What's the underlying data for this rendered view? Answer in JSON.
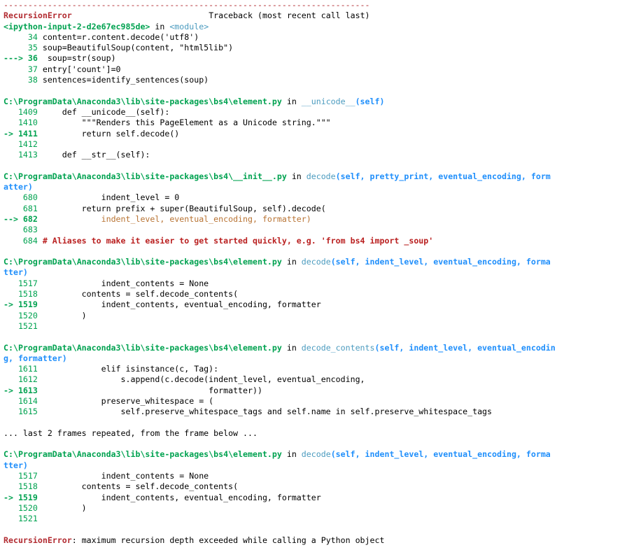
{
  "traceback": {
    "separator": "---------------------------------------------------------------------------",
    "error_name": "RecursionError",
    "header_gap": "                            ",
    "header_title": "Traceback (most recent call last)",
    "entry": {
      "module": "<ipython-input-2-d2e67ec985de>",
      "in": " in ",
      "func": "<module>",
      "lines": [
        {
          "num": "     34 ",
          "code": "content=r.content.decode('utf8')"
        },
        {
          "num": "     35 ",
          "code": "soup=BeautifulSoup(content, \"html5lib\")"
        },
        {
          "num": "---> 36 ",
          "code": " soup=str(soup)"
        },
        {
          "num": "     37 ",
          "code": "entry['count']=0"
        },
        {
          "num": "     38 ",
          "code": "sentences=identify_sentences(soup)"
        }
      ]
    },
    "frames": [
      {
        "path": "C:\\ProgramData\\Anaconda3\\lib\\site-packages\\bs4\\element.py",
        "in": " in ",
        "func": "__unicode__",
        "args": "(self)",
        "args_wrap": "",
        "lines": [
          {
            "num": "   1409 ",
            "code": "    def __unicode__(self):"
          },
          {
            "num": "   1410 ",
            "code": "        \"\"\"Renders this PageElement as a Unicode string.\"\"\""
          },
          {
            "num": "-> 1411 ",
            "code": "        return self.decode()"
          },
          {
            "num": "   1412 ",
            "code": ""
          },
          {
            "num": "   1413 ",
            "code": "    def __str__(self):"
          }
        ]
      },
      {
        "path": "C:\\ProgramData\\Anaconda3\\lib\\site-packages\\bs4\\__init__.py",
        "in": " in ",
        "func": "decode",
        "args": "(self, pretty_print, eventual_encoding, form",
        "args_wrap": "atter)",
        "lines": [
          {
            "num": "    680 ",
            "code": "            indent_level = 0"
          },
          {
            "num": "    681 ",
            "code": "        return prefix + super(BeautifulSoup, self).decode("
          },
          {
            "num": "--> 682 ",
            "code": "            indent_level, eventual_encoding, formatter)"
          },
          {
            "num": "    683 ",
            "code": ""
          },
          {
            "num": "    684 ",
            "code": "# Aliases to make it easier to get started quickly, e.g. 'from bs4 import _soup'"
          }
        ]
      },
      {
        "path": "C:\\ProgramData\\Anaconda3\\lib\\site-packages\\bs4\\element.py",
        "in": " in ",
        "func": "decode",
        "args": "(self, indent_level, eventual_encoding, forma",
        "args_wrap": "tter)",
        "lines": [
          {
            "num": "   1517 ",
            "code": "            indent_contents = None"
          },
          {
            "num": "   1518 ",
            "code": "        contents = self.decode_contents("
          },
          {
            "num": "-> 1519 ",
            "code": "            indent_contents, eventual_encoding, formatter"
          },
          {
            "num": "   1520 ",
            "code": "        )"
          },
          {
            "num": "   1521 ",
            "code": ""
          }
        ]
      },
      {
        "path": "C:\\ProgramData\\Anaconda3\\lib\\site-packages\\bs4\\element.py",
        "in": " in ",
        "func": "decode_contents",
        "args": "(self, indent_level, eventual_encodin",
        "args_wrap": "g, formatter)",
        "lines": [
          {
            "num": "   1611 ",
            "code": "            elif isinstance(c, Tag):"
          },
          {
            "num": "   1612 ",
            "code": "                s.append(c.decode(indent_level, eventual_encoding,"
          },
          {
            "num": "-> 1613 ",
            "code": "                                  formatter))"
          },
          {
            "num": "   1614 ",
            "code": "            preserve_whitespace = ("
          },
          {
            "num": "   1615 ",
            "code": "                self.preserve_whitespace_tags and self.name in self.preserve_whitespace_tags"
          }
        ]
      }
    ],
    "repeat_note": "... last 2 frames repeated, from the frame below ...",
    "last_frame": {
      "path": "C:\\ProgramData\\Anaconda3\\lib\\site-packages\\bs4\\element.py",
      "in": " in ",
      "func": "decode",
      "args": "(self, indent_level, eventual_encoding, forma",
      "args_wrap": "tter)",
      "lines": [
        {
          "num": "   1517 ",
          "code": "            indent_contents = None"
        },
        {
          "num": "   1518 ",
          "code": "        contents = self.decode_contents("
        },
        {
          "num": "-> 1519 ",
          "code": "            indent_contents, eventual_encoding, formatter"
        },
        {
          "num": "   1520 ",
          "code": "        )"
        },
        {
          "num": "   1521 ",
          "code": ""
        }
      ]
    },
    "final_error_name": "RecursionError",
    "final_message": ": maximum recursion depth exceeded while calling a Python object"
  }
}
